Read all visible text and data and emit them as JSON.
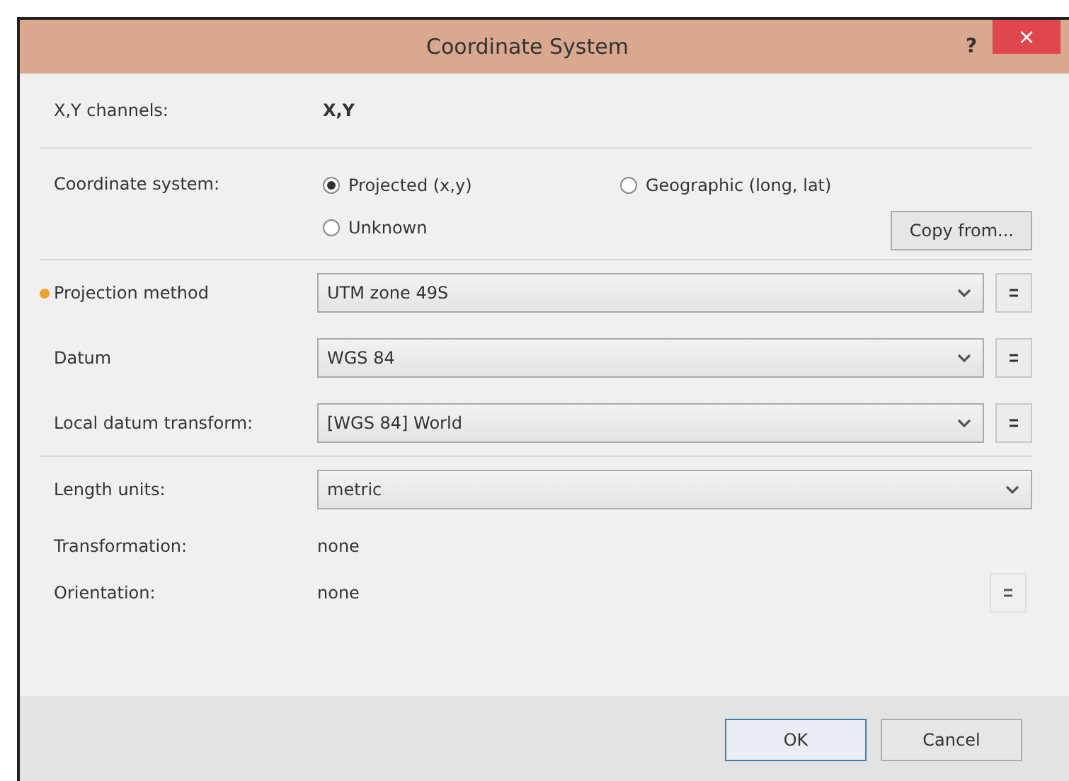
{
  "window": {
    "title": "Coordinate System",
    "help": "?",
    "close": "×"
  },
  "channels": {
    "label": "X,Y channels:",
    "value": "X,Y"
  },
  "coordinate_system": {
    "label": "Coordinate system:",
    "options": [
      {
        "label": "Projected (x,y)",
        "selected": true
      },
      {
        "label": "Geographic (long, lat)",
        "selected": false
      },
      {
        "label": "Unknown",
        "selected": false
      }
    ],
    "copy_button": "Copy from..."
  },
  "projection_rows": [
    {
      "label": "Projection method",
      "value": "UTM zone 49S",
      "required": true,
      "has_button": true
    },
    {
      "label": "Datum",
      "value": "WGS 84",
      "required": false,
      "has_button": true
    },
    {
      "label": "Local datum transform:",
      "value": "[WGS 84] World",
      "required": false,
      "has_button": true
    }
  ],
  "units": {
    "label": "Length units:",
    "value": "metric"
  },
  "info_rows": [
    {
      "label": "Transformation:",
      "value": "none",
      "has_button": false
    },
    {
      "label": "Orientation:",
      "value": "none",
      "has_button": true
    }
  ],
  "buttons": [
    {
      "label": "OK",
      "default": true
    },
    {
      "label": "Cancel",
      "default": false
    }
  ]
}
